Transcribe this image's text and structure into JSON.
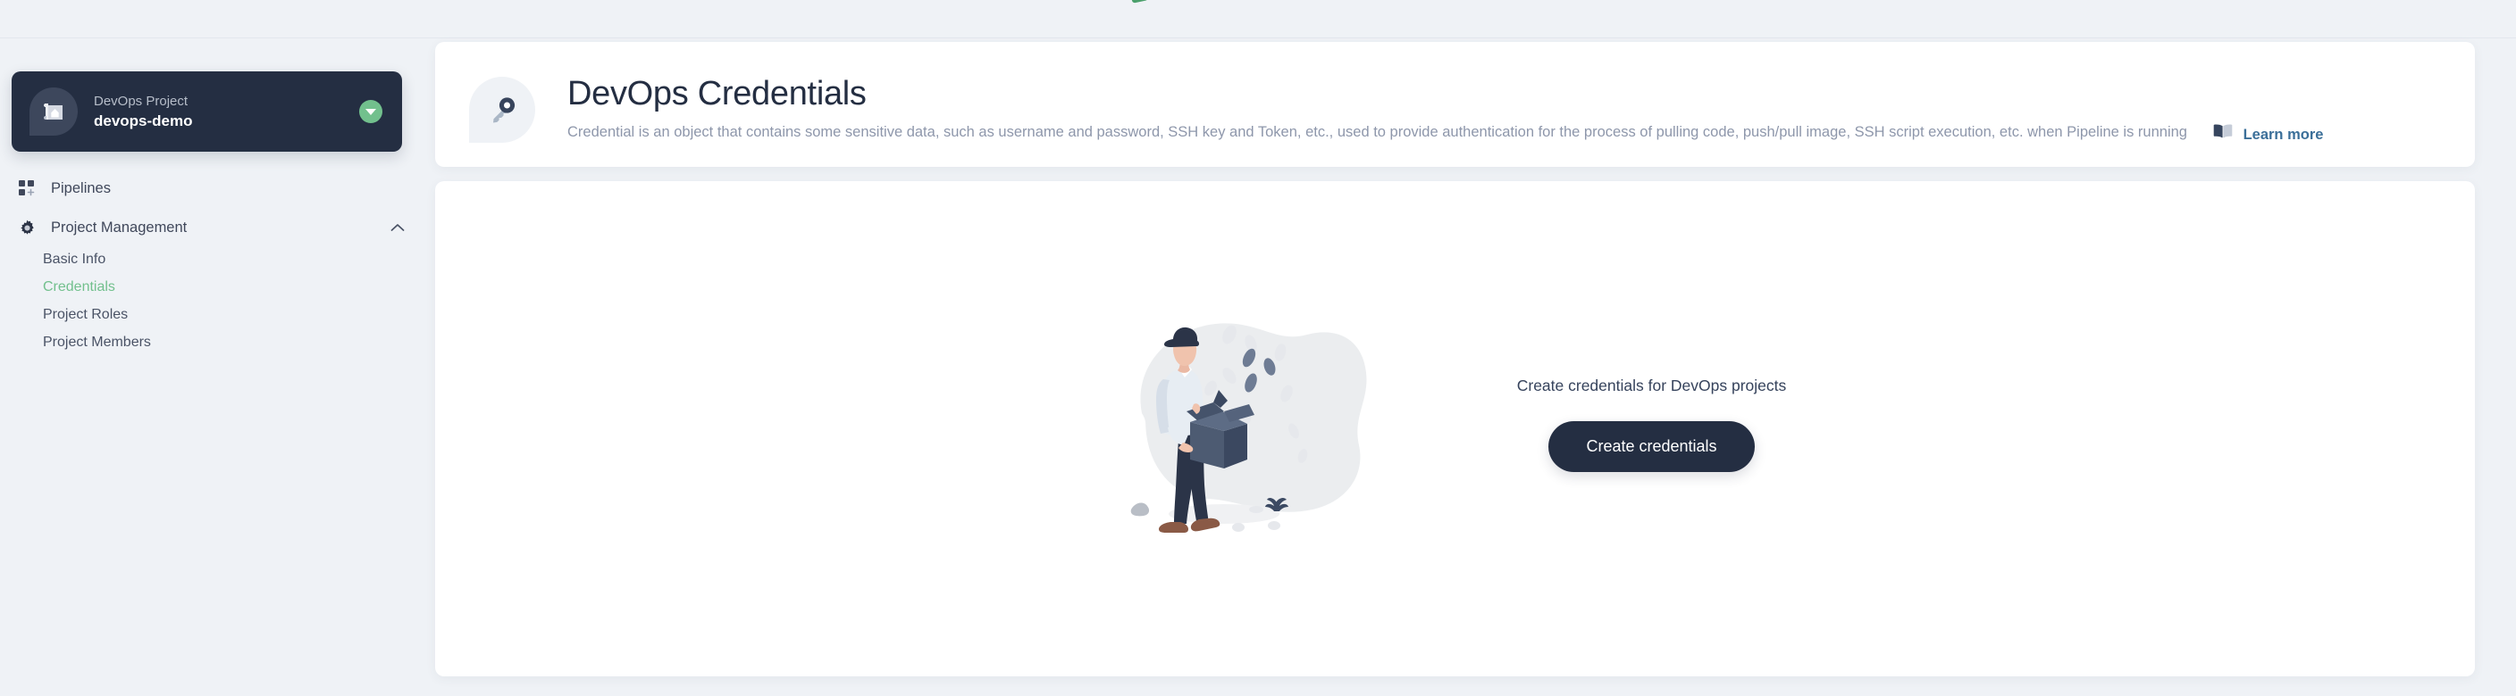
{
  "colors": {
    "page_background": "#eff2f6",
    "card_background": "#ffffff",
    "sidebar_project_card": "#242e42",
    "accent_green": "#72c08d",
    "link_blue": "#3b6f99",
    "primary_button": "#242e42",
    "muted_text": "#8e97ab",
    "heading_text": "#242e42"
  },
  "sidebar": {
    "project": {
      "kind_label": "DevOps Project",
      "name": "devops-demo",
      "avatar_icon": "blueprint-icon",
      "switch_icon": "chevron-down-circle-icon"
    },
    "nav": [
      {
        "id": "pipelines",
        "label": "Pipelines",
        "icon": "grid-plus-icon",
        "active": false,
        "expandable": false
      },
      {
        "id": "project-management",
        "label": "Project Management",
        "icon": "gear-icon",
        "active": false,
        "expandable": true,
        "expanded": true,
        "chevron_icon": "chevron-up-icon",
        "children": [
          {
            "id": "basic-info",
            "label": "Basic Info",
            "active": false
          },
          {
            "id": "credentials",
            "label": "Credentials",
            "active": true
          },
          {
            "id": "project-roles",
            "label": "Project Roles",
            "active": false
          },
          {
            "id": "project-members",
            "label": "Project Members",
            "active": false
          }
        ]
      }
    ]
  },
  "banner": {
    "icon": "key-icon",
    "title": "DevOps Credentials",
    "description": "Credential is an object that contains some sensitive data, such as username and password, SSH key and Token, etc., used to provide authentication for the process of pulling code, push/pull image, SSH script execution, etc. when Pipeline is running",
    "learn_more": {
      "icon": "book-icon",
      "label": "Learn more"
    }
  },
  "empty_state": {
    "illustration": "person-holding-box-illustration",
    "message": "Create credentials for DevOps projects",
    "action_label": "Create credentials"
  }
}
